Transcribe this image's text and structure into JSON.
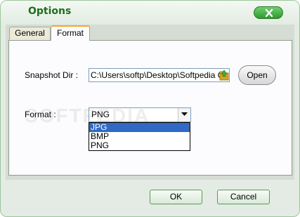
{
  "window": {
    "title": "Options"
  },
  "tabs": [
    {
      "label": "General",
      "active": false
    },
    {
      "label": "Format",
      "active": true
    }
  ],
  "snapshot_dir": {
    "label": "Snapshot Dir :",
    "value": "C:\\Users\\softp\\Desktop\\Softpedia Ou",
    "open_label": "Open"
  },
  "format": {
    "label": "Format :",
    "selected": "PNG",
    "options": [
      {
        "label": "JPG",
        "highlighted": true
      },
      {
        "label": "BMP",
        "highlighted": false
      },
      {
        "label": "PNG",
        "highlighted": false
      }
    ]
  },
  "watermark": {
    "text": "SOFTPEDIA"
  },
  "buttons": {
    "ok_label": "OK",
    "cancel_label": "Cancel"
  },
  "icons": {
    "close": "close-icon",
    "folder": "folder-icon",
    "dropdown_arrow": "chevron-down-icon"
  },
  "colors": {
    "title": "#1d6e1d",
    "active_tab_accent": "#f7a72a",
    "selection": "#316ac5",
    "close_button": "#3da83d"
  }
}
